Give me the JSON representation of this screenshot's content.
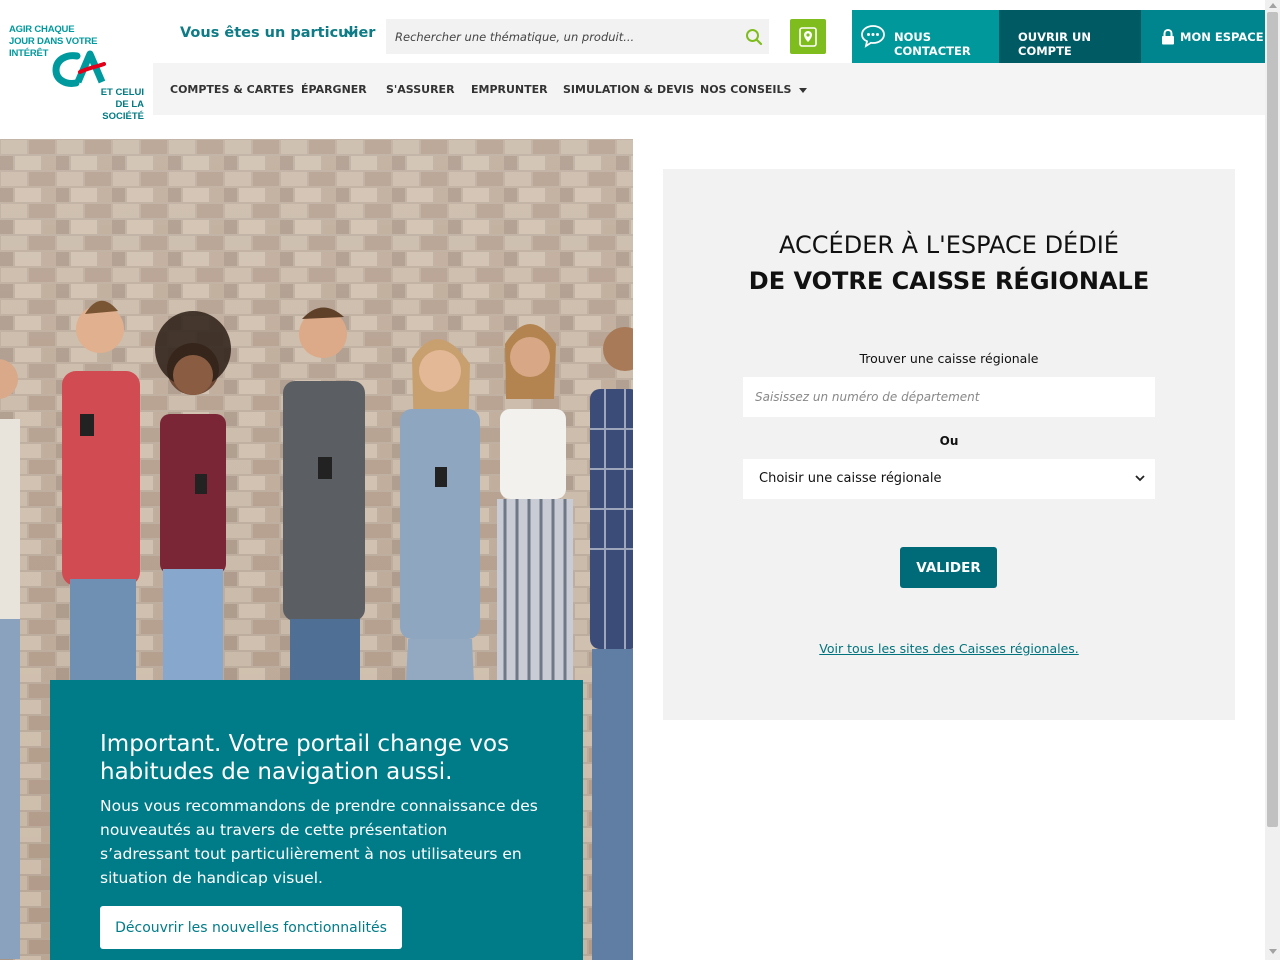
{
  "brand": {
    "tagline_top": [
      "AGIR CHAQUE",
      "JOUR DANS VOTRE",
      "INTÉRÊT"
    ],
    "tagline_bottom": [
      "ET CELUI",
      "DE LA SOCIÉTÉ"
    ],
    "logo_letters": "CA",
    "primary_color": "#00989a",
    "dark_color": "#005a64",
    "accent_green": "#7fbd1e",
    "logo_red": "#e2001a"
  },
  "header": {
    "profile_label": "Vous êtes un particulier",
    "search_placeholder": "Rechercher une thématique, un produit...",
    "contact_label": "NOUS CONTACTER",
    "open_account_label": "OUVRIR UN COMPTE",
    "my_space_label": "MON ESPACE"
  },
  "nav": {
    "items": [
      {
        "label": "COMPTES & CARTES"
      },
      {
        "label": "ÉPARGNER"
      },
      {
        "label": "S'ASSURER"
      },
      {
        "label": "EMPRUNTER"
      },
      {
        "label": "SIMULATION & DEVIS"
      },
      {
        "label": "NOS CONSEILS"
      }
    ]
  },
  "info": {
    "title": "Important. Votre portail change vos habitudes de navigation aussi.",
    "text": "Nous vous recommandons de prendre connaissance des nouveautés au travers de cette présentation s’adressant tout particulièrement à nos utilisateurs en situation de handicap visuel.",
    "button_label": "Découvrir les nouvelles fonctionnalités"
  },
  "panel": {
    "title_line1": "ACCÉDER À L'ESPACE DÉDIÉ",
    "title_line2": "DE VOTRE CAISSE RÉGIONALE",
    "find_label": "Trouver une caisse régionale",
    "dept_placeholder": "Saisissez un numéro de département",
    "or_label": "Ou",
    "select_value": "Choisir une caisse régionale",
    "validate_label": "VALIDER",
    "all_sites_link": "Voir tous les sites des Caisses régionales."
  }
}
